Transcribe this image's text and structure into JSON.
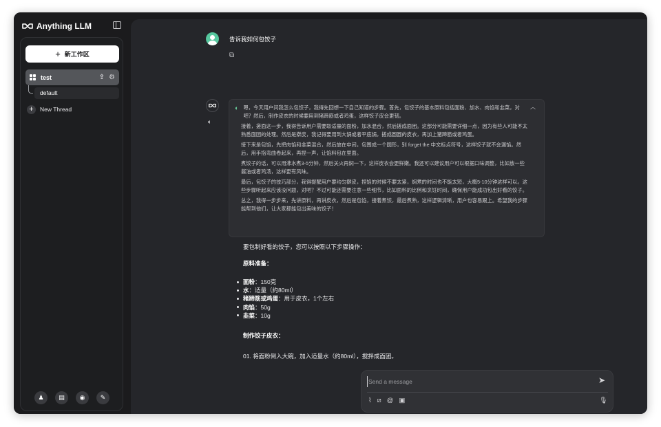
{
  "app": {
    "brand": "Anything LLM"
  },
  "sidebar": {
    "new_workspace": "新工作区",
    "workspace": {
      "name": "test"
    },
    "threads": [
      {
        "label": "default"
      }
    ],
    "new_thread": "New Thread",
    "footer_icons": [
      "github-icon",
      "docs-icon",
      "discord-icon",
      "settings-icon"
    ]
  },
  "chat": {
    "user_message": "告诉我如何包饺子",
    "thinking": [
      "嗯，今天用户问我怎么包饺子，我得先回想一下自己知道的步骤。首先，包饺子的基本原料包括面粉、加水、肉馅和韭菜，对吧？然后，制作皮衣的时候要用到猪蹄筋或者鸡蛋，这样饺子皮会更韧。",
      "接着，搓面这一步，我得告诉用户需要取适量的面粉，加水混合，然后搓成面团。这部分可能需要详细一点，因为有些人可能不太熟悉面团的处理。然后是擀皮，我记得要用到大锅或者平底锅，搓成圆圆的皮衣，再加上猪蹄筋或者鸡蛋。",
      "接下来是包馅，先把肉馅和韭菜混合，然后放在中间，包围成一个圆形，别 forget the 中文标点符号，这样饺子就不会漏馅。然后，用手指弯曲卷起来，再捏一声，让馅料包在里面。",
      "煮饺子的话，可以用沸水煮3-5分钟，然后关火再焖一下，这样皮衣会更鲜嫩。我还可以建议用户可以根据口味调整，比如放一些酱油或者鸡汤，这样更有风味。",
      "最后，包饺子的技巧部分，我得提醒用户要均匀擀皮，捏馅的时候不要太紧，焖煮的时间也不能太短，大概5-10分钟这样可以。这些步骤听起来应该没问题，对吧？不过可能还需要注意一些细节，比如面料的比例和烹饪时间，确保用户能成功包出好看的饺子。",
      "总之，我得一步步来，先讲原料，再讲皮衣，然后是包馅，接着煮饺，最后煮熟，这样逻辑清晰，用户也容易跟上。希望我的步骤能帮到他们，让大家都能包出美味的饺子！"
    ],
    "answer": {
      "intro": "要包制好看的饺子，您可以按照以下步骤操作：",
      "ingredients_heading": "原料准备：",
      "ingredients": [
        {
          "name": "面粉",
          "amount": "：150克"
        },
        {
          "name": "水",
          "amount": "：适量（约80ml）"
        },
        {
          "name": "猪蹄筋或鸡蛋",
          "amount": "：用于皮衣，1个左右"
        },
        {
          "name": "肉馅",
          "amount": "：50g"
        },
        {
          "name": "韭菜",
          "amount": "：10g"
        }
      ],
      "wrapper_heading": "制作饺子皮衣：",
      "step_1": "01.  将面粉倒入大碗，加入适量水（约80ml），搅拌成面团。"
    }
  },
  "composer": {
    "placeholder": "Send a message",
    "value": ""
  }
}
